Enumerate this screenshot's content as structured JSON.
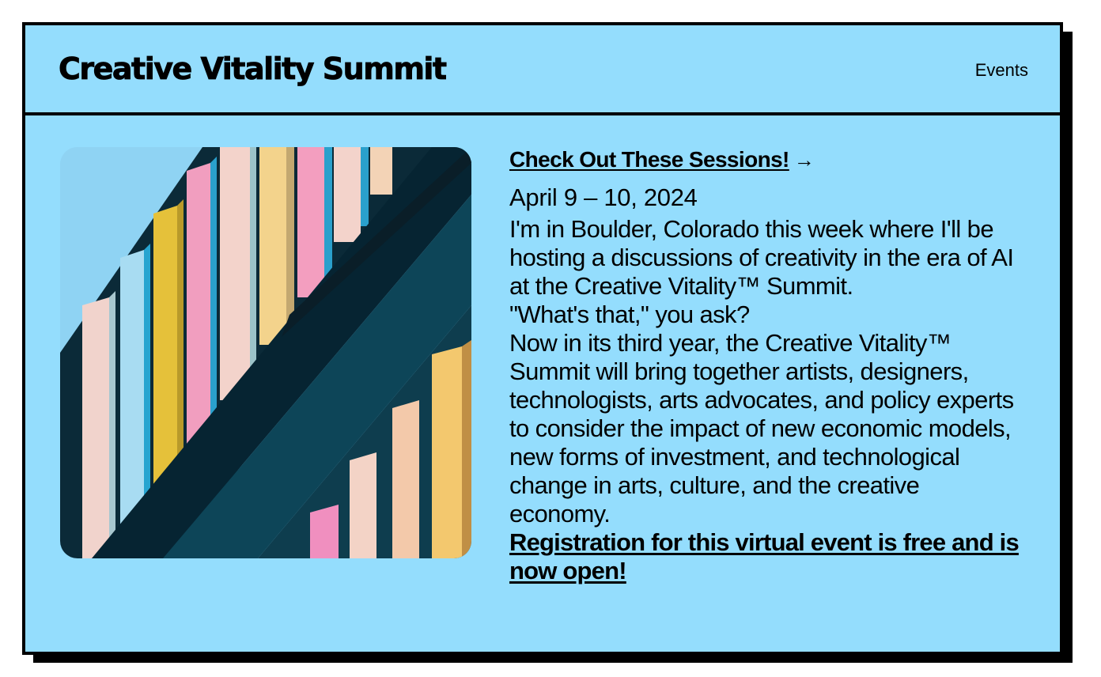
{
  "header": {
    "title": "Creative Vitality Summit",
    "nav_events": "Events"
  },
  "post": {
    "sessions_link": "Check Out These Sessions!",
    "arrow_icon": "→",
    "date": "April 9 – 10, 2024",
    "intro": "I'm in Boulder, Colorado this week where I'll be hosting a discussions of creativity in the era of AI at the Creative Vitality™ Summit.",
    "question": "\"What's that,\" you ask?",
    "description": "Now in its third year, the Creative Vitality™ Summit will bring together artists, designers, technologists, arts advocates, and policy experts to consider the impact of new economic models, new forms of investment, and technological change in arts, culture, and the creative economy.",
    "registration": "Registration for this virtual event is free and is now open!"
  },
  "colors": {
    "background": "#94ddfd",
    "border": "#000000"
  }
}
